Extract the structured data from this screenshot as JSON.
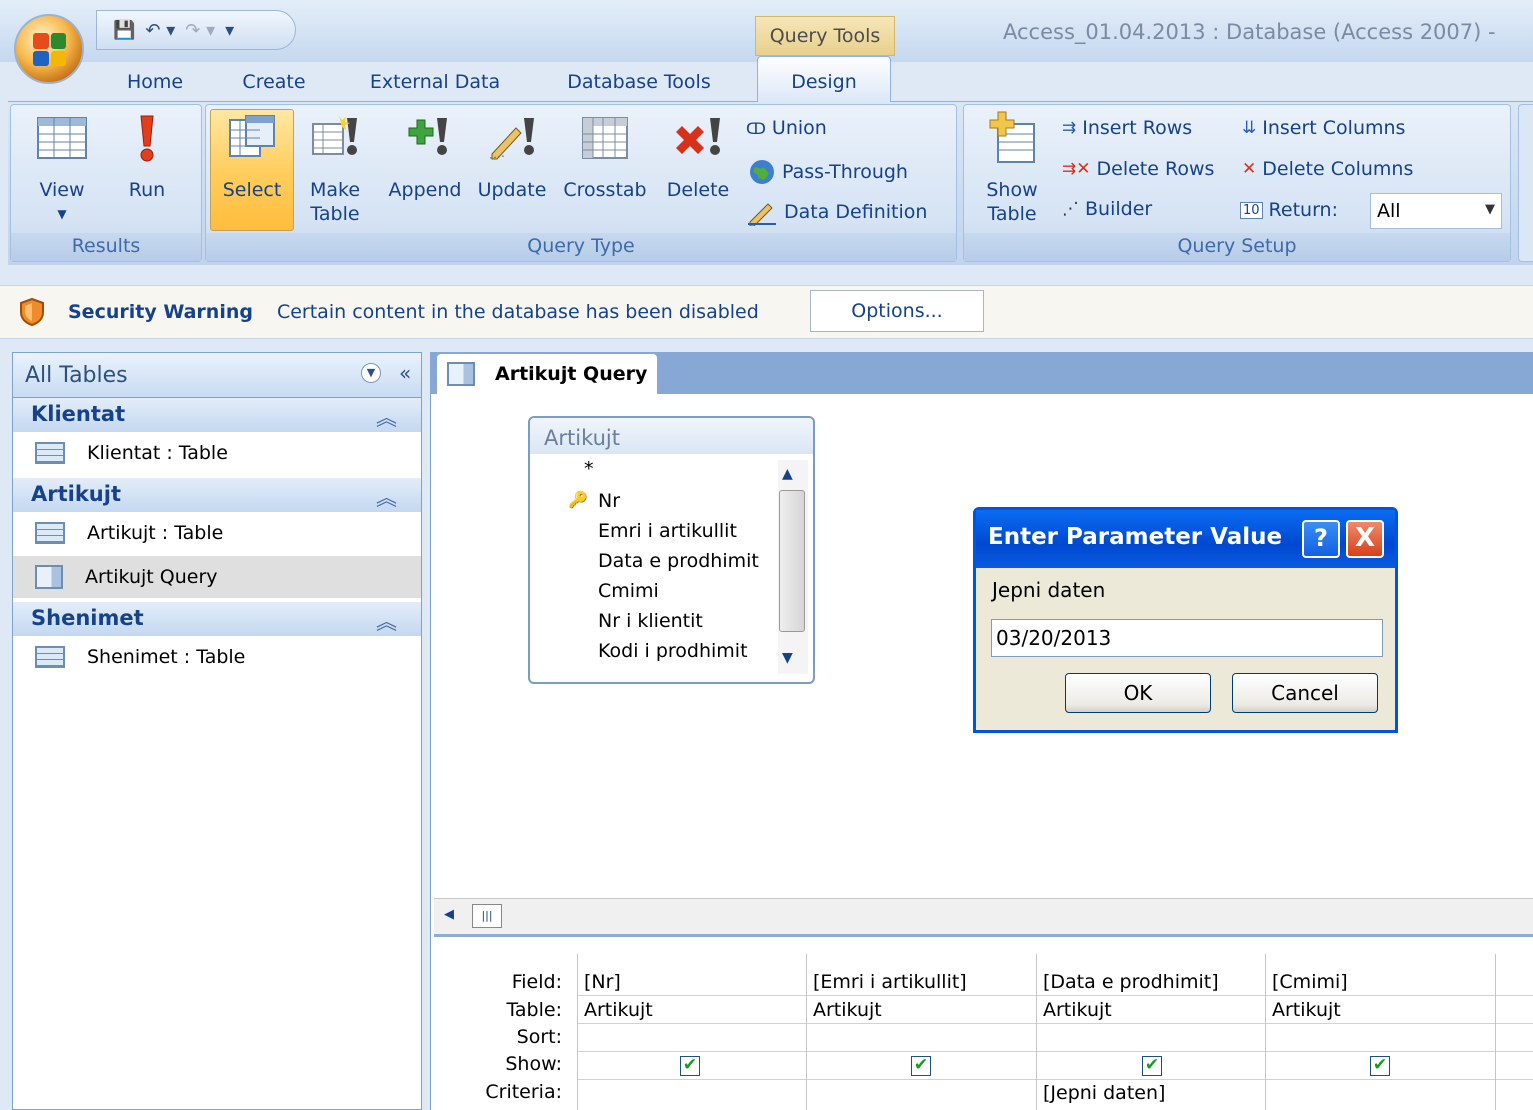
{
  "window": {
    "title": "Access_01.04.2013 : Database (Access 2007) -",
    "contextual_group": "Query Tools"
  },
  "ribbon_tabs": [
    "Home",
    "Create",
    "External Data",
    "Database Tools",
    "Design"
  ],
  "groups": {
    "results": {
      "label": "Results",
      "view": "View",
      "run": "Run"
    },
    "query_type": {
      "label": "Query Type",
      "select": "Select",
      "make_table_1": "Make",
      "make_table_2": "Table",
      "append": "Append",
      "update": "Update",
      "crosstab": "Crosstab",
      "delete": "Delete",
      "union": "Union",
      "pass_through": "Pass-Through",
      "data_definition": "Data Definition"
    },
    "query_setup": {
      "label": "Query Setup",
      "show_table_1": "Show",
      "show_table_2": "Table",
      "insert_rows": "Insert Rows",
      "delete_rows": "Delete Rows",
      "builder": "Builder",
      "insert_columns": "Insert Columns",
      "delete_columns": "Delete Columns",
      "return_label": "Return:",
      "return_value": "All"
    }
  },
  "security": {
    "title": "Security Warning",
    "message": "Certain content in the database has been disabled",
    "options": "Options..."
  },
  "nav": {
    "header": "All Tables",
    "groups": [
      {
        "name": "Klientat",
        "items": [
          "Klientat : Table"
        ]
      },
      {
        "name": "Artikujt",
        "items": [
          "Artikujt : Table",
          "Artikujt Query"
        ]
      },
      {
        "name": "Shenimet",
        "items": [
          "Shenimet : Table"
        ]
      }
    ]
  },
  "doc_tab": "Artikujt Query",
  "field_list": {
    "title": "Artikujt",
    "fields": [
      "*",
      "Nr",
      "Emri i artikullit",
      "Data e prodhimit",
      "Cmimi",
      "Nr i klientit",
      "Kodi i prodhimit"
    ]
  },
  "dialog": {
    "title": "Enter Parameter Value",
    "help": "?",
    "close": "X",
    "prompt": "Jepni daten",
    "value": "03/20/2013",
    "ok": "OK",
    "cancel": "Cancel"
  },
  "grid": {
    "row_labels": [
      "Field:",
      "Table:",
      "Sort:",
      "Show:",
      "Criteria:"
    ],
    "columns": [
      {
        "field": "[Nr]",
        "table": "Artikujt",
        "criteria": ""
      },
      {
        "field": "[Emri i artikullit]",
        "table": "Artikujt",
        "criteria": ""
      },
      {
        "field": "[Data e prodhimit]",
        "table": "Artikujt",
        "criteria": "[Jepni daten]"
      },
      {
        "field": "[Cmimi]",
        "table": "Artikujt",
        "criteria": ""
      }
    ]
  }
}
